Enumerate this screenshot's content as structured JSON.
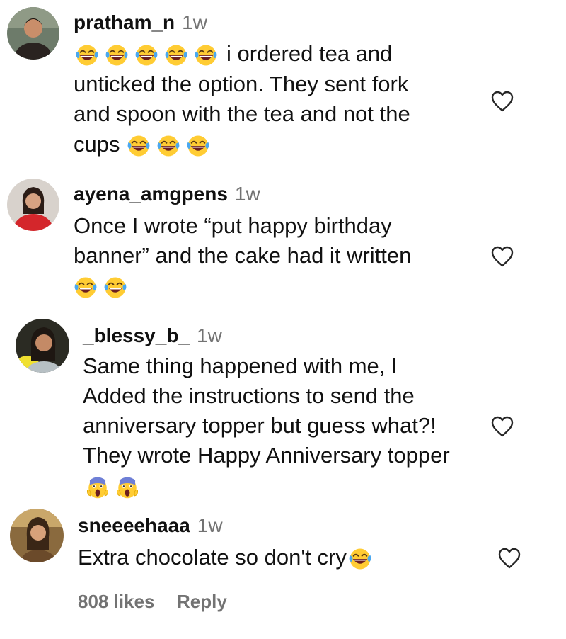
{
  "comments": [
    {
      "username": "pratham_n",
      "time": "1w",
      "lines": [
        "i ordered tea and",
        "unticked the option. They sent fork",
        "and spoon with the tea and not the",
        "cups"
      ],
      "emoji": "laughing-tears"
    },
    {
      "username": "ayena_amgpens",
      "time": "1w",
      "lines": [
        "Once I wrote “put happy birthday",
        "banner” and the cake had it written"
      ],
      "emoji": "laughing-tears"
    },
    {
      "username": "_blessy_b_",
      "time": "1w",
      "lines": [
        "Same thing happened with me, I",
        "Added the instructions to send the",
        "anniversary topper but guess what?!",
        "They wrote Happy Anniversary topper"
      ],
      "emoji": "screaming-face"
    },
    {
      "username": "sneeeehaaa",
      "time": "1w",
      "lines": [
        "Extra chocolate so don't cry"
      ],
      "emoji": "laughing-tears"
    }
  ],
  "footer": {
    "likes": "808 likes",
    "reply": "Reply"
  },
  "colors": {
    "text": "#111111",
    "muted": "#737373",
    "background": "#ffffff"
  }
}
